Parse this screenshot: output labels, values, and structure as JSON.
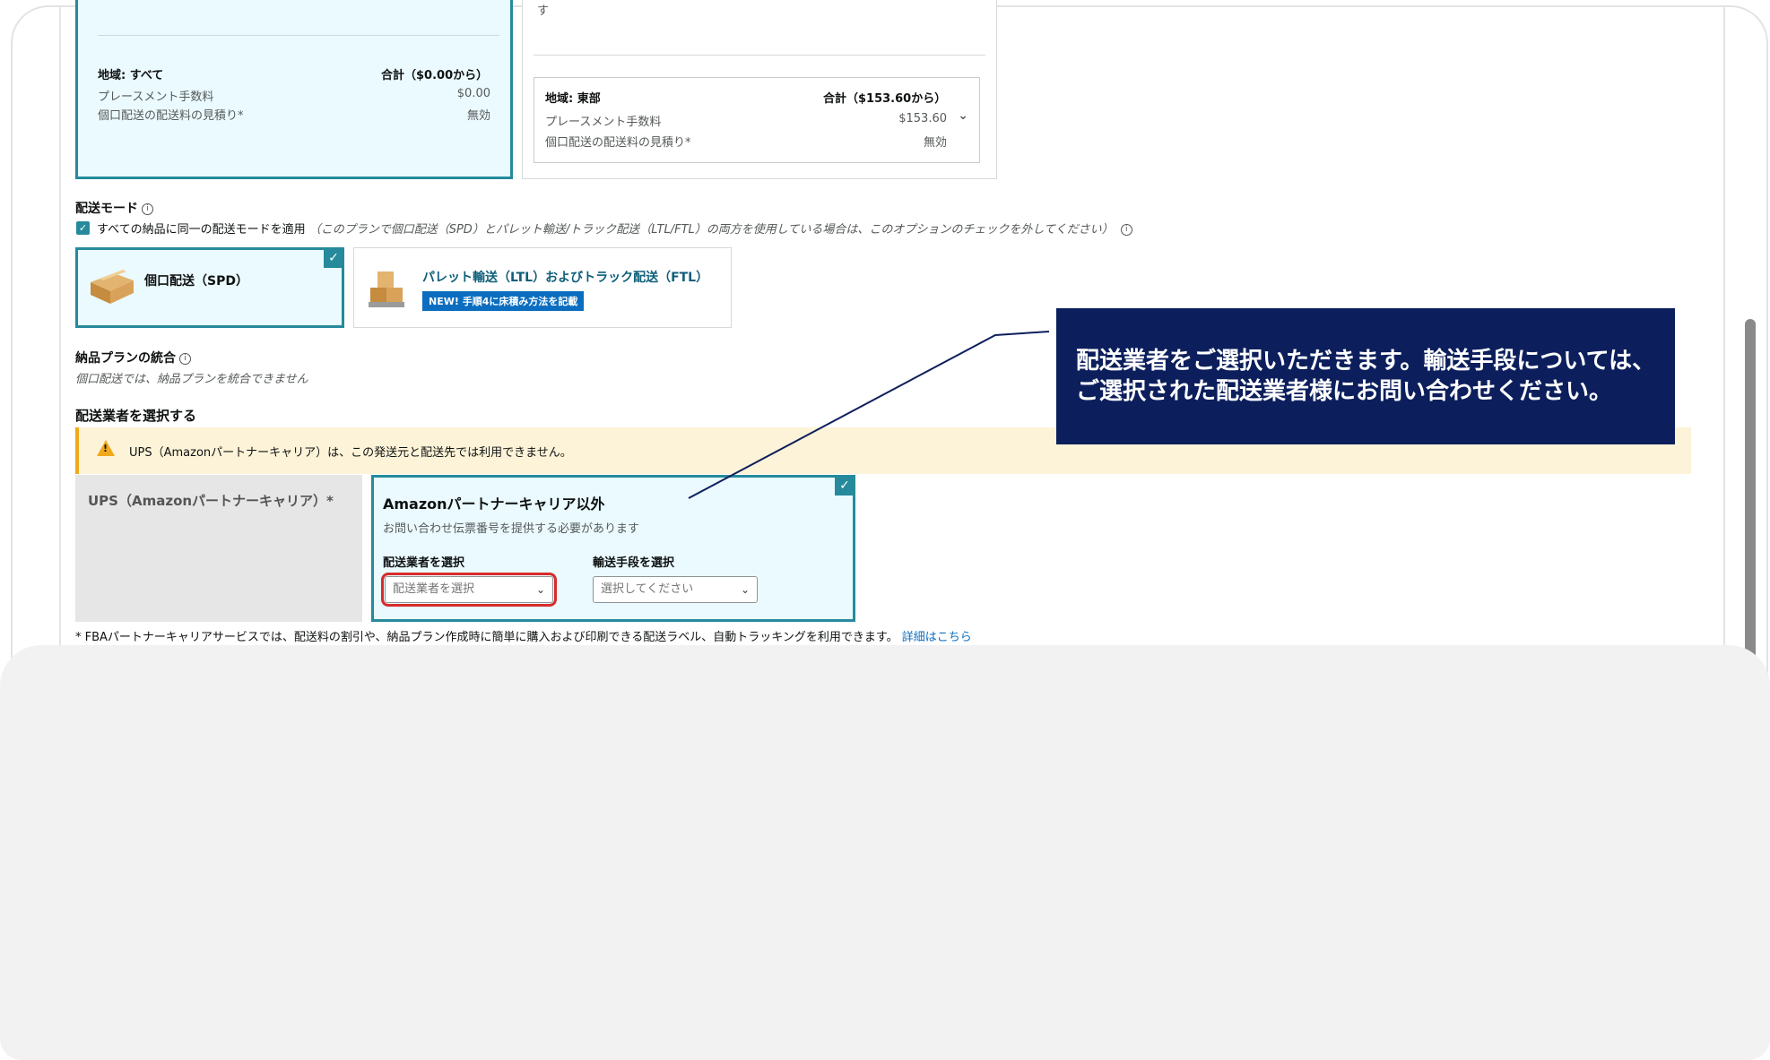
{
  "region_left": {
    "region_label": "地域: すべて",
    "total_label": "合計（$0.00から）",
    "placement_fee_label": "プレースメント手数料",
    "placement_fee_value": "$0.00",
    "shipping_estimate_label": "個口配送の配送料の見積り*",
    "shipping_estimate_value": "無効"
  },
  "region_right": {
    "top_note": "す",
    "region_label": "地域: 東部",
    "total_label": "合計（$153.60から）",
    "placement_fee_label": "プレースメント手数料",
    "placement_fee_value": "$153.60",
    "shipping_estimate_label": "個口配送の配送料の見積り*",
    "shipping_estimate_value": "無効"
  },
  "shipping_mode": {
    "title": "配送モード",
    "checkbox_label": "すべての納品に同一の配送モードを適用",
    "checkbox_note": "（このプランで個口配送（SPD）とパレット輸送/トラック配送（LTL/FTL）の両方を使用している場合は、このオプションのチェックを外してください）",
    "spd_label": "個口配送（SPD）",
    "ltl_label": "パレット輸送（LTL）およびトラック配送（FTL）",
    "ltl_badge": "NEW! 手順4に床積み方法を記載"
  },
  "consolidation": {
    "title": "納品プランの統合",
    "note": "個口配送では、納品プランを統合できません"
  },
  "carrier": {
    "title": "配送業者を選択する",
    "warning": "UPS（Amazonパートナーキャリア）は、この発送元と配送先では利用できません。",
    "ups_label": "UPS（Amazonパートナーキャリア）*",
    "other_title": "Amazonパートナーキャリア以外",
    "other_sub": "お問い合わせ伝票番号を提供する必要があります",
    "carrier_select_label": "配送業者を選択",
    "carrier_select_value": "配送業者を選択",
    "transport_select_label": "輸送手段を選択",
    "transport_select_value": "選択してください"
  },
  "footnote": {
    "text": "* FBAパートナーキャリアサービスでは、配送料の割引や、納品プラン作成時に簡単に購入および印刷できる配送ラベル、自動トラッキングを利用できます。",
    "link": "詳細はこちら"
  },
  "callout": {
    "text": "配送業者をご選択いただきます。輸送手段については、ご選択された配送業者様にお問い合わせください。"
  },
  "icons": {
    "check": "✓",
    "chevron": "⌄",
    "info": "i",
    "warning": "!"
  },
  "colors": {
    "accent": "#268a9c",
    "callout_bg": "#0c1f5c",
    "highlight": "#d72c2c",
    "warning_bg": "#fdf3d8",
    "badge": "#0a6dbf"
  }
}
